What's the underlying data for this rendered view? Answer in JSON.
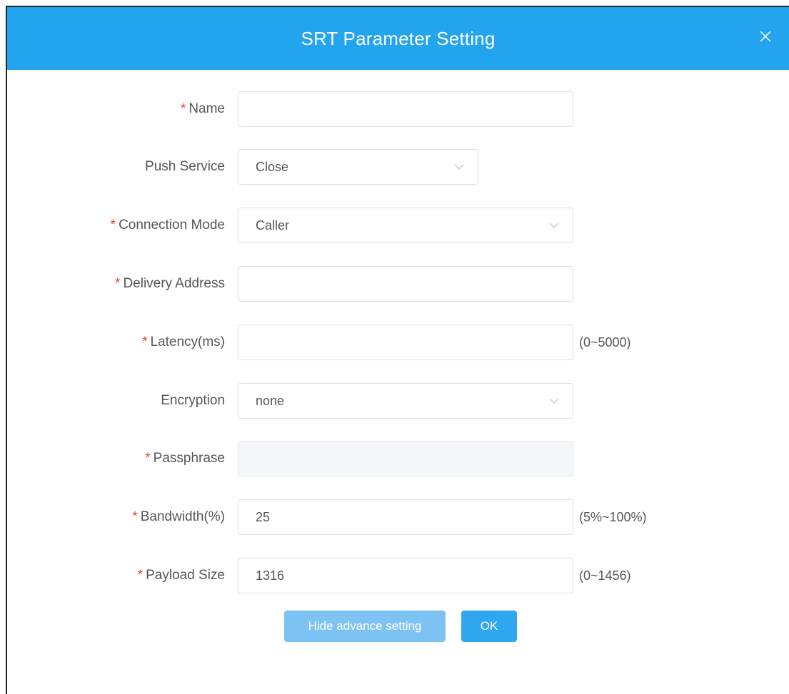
{
  "dialog": {
    "title": "SRT Parameter Setting",
    "close_icon": "close-icon"
  },
  "fields": {
    "name": {
      "required": "*",
      "label": "Name",
      "value": ""
    },
    "push_service": {
      "required": "",
      "label": "Push Service",
      "value": "Close"
    },
    "connection_mode": {
      "required": "*",
      "label": "Connection Mode",
      "value": "Caller"
    },
    "delivery_address": {
      "required": "*",
      "label": "Delivery Address",
      "value": ""
    },
    "latency": {
      "required": "*",
      "label": "Latency(ms)",
      "value": "",
      "hint": "(0~5000)"
    },
    "encryption": {
      "required": "",
      "label": "Encryption",
      "value": "none"
    },
    "passphrase": {
      "required": "*",
      "label": "Passphrase",
      "value": ""
    },
    "bandwidth": {
      "required": "*",
      "label": "Bandwidth(%)",
      "value": "25",
      "hint": "(5%~100%)"
    },
    "payload_size": {
      "required": "*",
      "label": "Payload Size",
      "value": "1316",
      "hint": "(0~1456)"
    }
  },
  "buttons": {
    "hide_advance": "Hide advance setting",
    "ok": "OK"
  },
  "colors": {
    "header": "#22a5ee",
    "required_mark": "#e0463f",
    "primary_button": "#2ea7f0",
    "secondary_button": "#7cc3f3"
  }
}
